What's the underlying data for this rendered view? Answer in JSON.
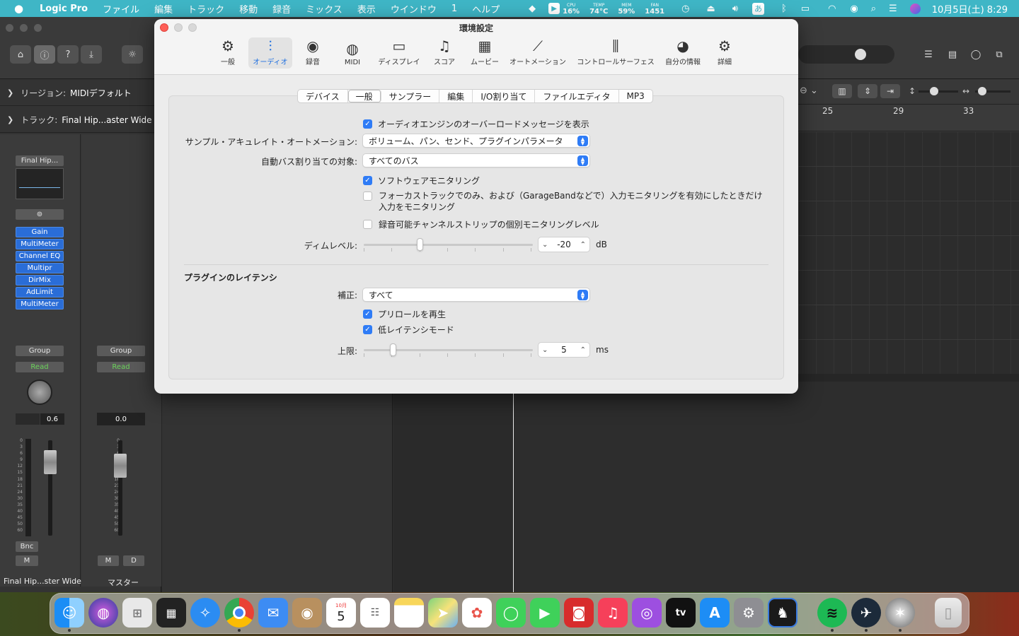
{
  "menubar": {
    "items": [
      "Logic Pro",
      "ファイル",
      "編集",
      "トラック",
      "移動",
      "録音",
      "ミックス",
      "表示",
      "ウインドウ",
      "1",
      "ヘルプ"
    ],
    "stats": [
      {
        "k": "CPU",
        "v": "16%"
      },
      {
        "k": "TEMP",
        "v": "74°C"
      },
      {
        "k": "MEM",
        "v": "59%"
      },
      {
        "k": "FAN",
        "v": "1451"
      }
    ],
    "input_mode": "あ",
    "clock": "10月5日(土) 8:29"
  },
  "inspector": {
    "region_prefix": "リージョン:",
    "region_value": "MIDIデフォルト",
    "track_prefix": "トラック:",
    "track_value": "Final Hip...aster Wide"
  },
  "strip_a": {
    "setting": "Final Hip...",
    "plugins": [
      "Gain",
      "MultiMeter",
      "Channel EQ",
      "Multipr",
      "DirMix",
      "AdLimit",
      "MultiMeter"
    ],
    "group": "Group",
    "automation": "Read",
    "pan_value": "0.6",
    "bounce": "Bnc",
    "mute": "M",
    "name": "Final Hip...ster Wide"
  },
  "strip_b": {
    "group": "Group",
    "automation": "Read",
    "value": "0.0",
    "mute": "M",
    "dim": "D",
    "name": "マスター"
  },
  "meter_scale": [
    "0",
    "3",
    "6",
    "9",
    "12",
    "15",
    "18",
    "21",
    "24",
    "30",
    "35",
    "40",
    "45",
    "50",
    "60"
  ],
  "ruler": [
    "25",
    "29",
    "33"
  ],
  "prefs": {
    "title": "環境設定",
    "tabs": [
      {
        "label": "一般",
        "icon": "gear-icon"
      },
      {
        "label": "オーディオ",
        "icon": "waveform-icon",
        "selected": true
      },
      {
        "label": "録音",
        "icon": "record-icon"
      },
      {
        "label": "MIDI",
        "icon": "midi-port-icon"
      },
      {
        "label": "ディスプレイ",
        "icon": "display-icon"
      },
      {
        "label": "スコア",
        "icon": "music-notes-icon"
      },
      {
        "label": "ムービー",
        "icon": "film-icon"
      },
      {
        "label": "オートメーション",
        "icon": "automation-icon"
      },
      {
        "label": "コントロールサーフェス",
        "icon": "sliders-icon"
      },
      {
        "label": "自分の情報",
        "icon": "person-icon"
      },
      {
        "label": "詳細",
        "icon": "gears-icon"
      }
    ],
    "subtabs": [
      "デバイス",
      "一般",
      "サンプラー",
      "編集",
      "I/O割り当て",
      "ファイルエディタ",
      "MP3"
    ],
    "selected_subtab": "一般",
    "overload_msg": {
      "label": "オーディオエンジンのオーバーロードメッセージを表示",
      "checked": true
    },
    "sample_accurate": {
      "label": "サンプル・アキュレイト・オートメーション:",
      "value": "ボリューム、パン、センド、プラグインパラメータ"
    },
    "auto_bus": {
      "label": "自動バス割り当ての対象:",
      "value": "すべてのバス"
    },
    "software_monitoring": {
      "label": "ソフトウェアモニタリング",
      "checked": true
    },
    "focused_track": {
      "label_line1": "フォーカストラックでのみ、および（GarageBandなどで）入力モニタリングを有効にしたときだけ",
      "label_line2": "入力をモニタリング",
      "checked": false
    },
    "individual_monitoring": {
      "label": "録音可能チャンネルストリップの個別モニタリングレベル",
      "checked": false
    },
    "dim_level": {
      "label": "ディムレベル:",
      "value": "-20",
      "unit": "dB"
    },
    "plugin_latency": {
      "section": "プラグインのレイテンシ",
      "compensation": {
        "label": "補正:",
        "value": "すべて"
      },
      "preroll": {
        "label": "プリロールを再生",
        "checked": true
      },
      "low_latency": {
        "label": "低レイテンシモード",
        "checked": true
      },
      "limit": {
        "label": "上限:",
        "value": "5",
        "unit": "ms"
      }
    }
  },
  "colors": {
    "menubar": "#3fb6c6",
    "accent": "#2f7cf6",
    "close": "#fe5f57"
  },
  "dock": [
    "Finder",
    "Siri",
    "Launchpad",
    "Mission Control",
    "Safari",
    "Chrome",
    "Mail",
    "Contacts",
    "Calendar",
    "Reminders",
    "Notes",
    "Maps",
    "Photos",
    "Messages",
    "FaceTime",
    "Photo Booth",
    "Music",
    "Podcasts",
    "TV",
    "App Store",
    "System Settings",
    "Reading",
    "Spotify",
    "Utility",
    "Compressor",
    "Trash"
  ],
  "calendar": {
    "month": "10月",
    "day": "5"
  }
}
